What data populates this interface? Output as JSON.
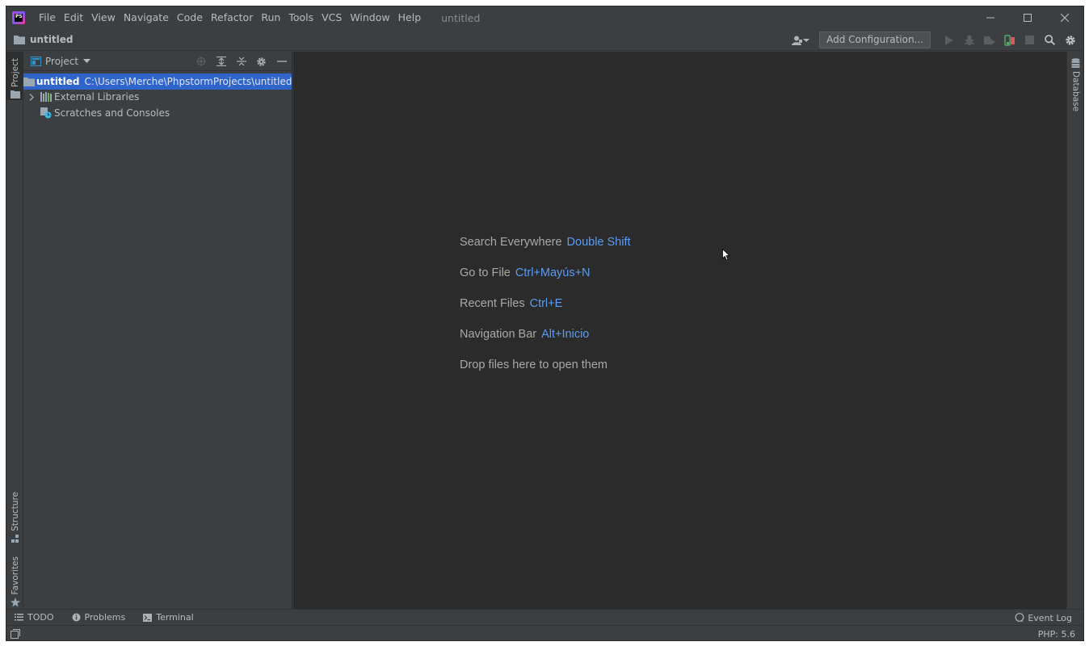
{
  "app": {
    "logo_text": "PS",
    "window_title": "untitled"
  },
  "menu": [
    "File",
    "Edit",
    "View",
    "Navigate",
    "Code",
    "Refactor",
    "Run",
    "Tools",
    "VCS",
    "Window",
    "Help"
  ],
  "navbar": {
    "project_name": "untitled",
    "add_configuration_label": "Add Configuration..."
  },
  "left_stripe": {
    "project_label": "Project",
    "structure_label": "Structure",
    "favorites_label": "Favorites"
  },
  "right_stripe": {
    "database_label": "Database"
  },
  "project_panel": {
    "title": "Project",
    "tree": [
      {
        "name": "untitled",
        "path": "C:\\Users\\Merche\\PhpstormProjects\\untitled",
        "selected": true
      },
      {
        "name": "External Libraries"
      },
      {
        "name": "Scratches and Consoles"
      }
    ]
  },
  "editor": {
    "hints": [
      {
        "label": "Search Everywhere",
        "key": "Double Shift"
      },
      {
        "label": "Go to File",
        "key": "Ctrl+Mayús+N"
      },
      {
        "label": "Recent Files",
        "key": "Ctrl+E"
      },
      {
        "label": "Navigation Bar",
        "key": "Alt+Inicio"
      },
      {
        "label": "Drop files here to open them",
        "key": ""
      }
    ]
  },
  "bottom_bar": {
    "todo": "TODO",
    "problems": "Problems",
    "terminal": "Terminal",
    "event_log": "Event Log"
  },
  "status_bar": {
    "php_version": "PHP: 5.6"
  },
  "colors": {
    "panel_bg": "#3c3f41",
    "editor_bg": "#2b2b2b",
    "selection": "#2f65ca",
    "accent_key": "#589df6"
  }
}
